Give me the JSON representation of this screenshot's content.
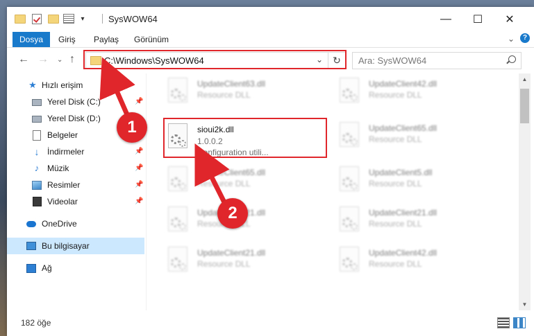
{
  "window": {
    "title": "SysWOW64",
    "minimize_glyph": "—",
    "maximize_glyph": "☐",
    "close_glyph": "✕"
  },
  "ribbon": {
    "tabs": [
      "Dosya",
      "Giriş",
      "Paylaş",
      "Görünüm"
    ]
  },
  "navigation": {
    "address": "C:\\Windows\\SysWOW64",
    "search_placeholder": "Ara: SysWOW64"
  },
  "sidebar": {
    "items": [
      {
        "label": "Hızlı erişim",
        "icon": "star-icon"
      },
      {
        "label": "Yerel Disk (C:)",
        "icon": "drive-icon",
        "pinned": true
      },
      {
        "label": "Yerel Disk (D:)",
        "icon": "drive-icon"
      },
      {
        "label": "Belgeler",
        "icon": "documents-icon"
      },
      {
        "label": "İndirmeler",
        "icon": "download-icon",
        "pinned": true
      },
      {
        "label": "Müzik",
        "icon": "music-icon",
        "pinned": true
      },
      {
        "label": "Resimler",
        "icon": "pictures-icon",
        "pinned": true
      },
      {
        "label": "Videolar",
        "icon": "videos-icon",
        "pinned": true
      },
      {
        "label": "OneDrive",
        "icon": "cloud-icon"
      },
      {
        "label": "Bu bilgisayar",
        "icon": "computer-icon",
        "selected": true
      },
      {
        "label": "Ağ",
        "icon": "network-icon"
      }
    ]
  },
  "files": {
    "highlighted": {
      "name": "sioui2k.dll",
      "version": "1.0.0.2",
      "description": "Configuration utili..."
    },
    "left_column": [
      {
        "name": "UpdateClient63.dll",
        "sub": "Resource DLL"
      },
      {
        "name": "UpdateClient65.dll",
        "sub": "Resource DLL"
      },
      {
        "name": "UpdateClient21.dll",
        "sub": "Resource DLL"
      },
      {
        "name": "UpdateClient21.dll",
        "sub": "Resource DLL"
      }
    ],
    "right_column": [
      {
        "name": "UpdateClient42.dll",
        "sub": "Resource DLL"
      },
      {
        "name": "UpdateClient65.dll",
        "sub": "Resource DLL"
      },
      {
        "name": "UpdateClient5.dll",
        "sub": "Resource DLL"
      },
      {
        "name": "UpdateClient21.dll",
        "sub": "Resource DLL"
      },
      {
        "name": "UpdateClient42.dll",
        "sub": "Resource DLL"
      }
    ]
  },
  "status": {
    "item_count": "182 öğe"
  },
  "callouts": [
    "1",
    "2"
  ],
  "colors": {
    "accent": "#1979ca",
    "highlight_red": "#e0262b",
    "selected_bg": "#cce8ff"
  }
}
